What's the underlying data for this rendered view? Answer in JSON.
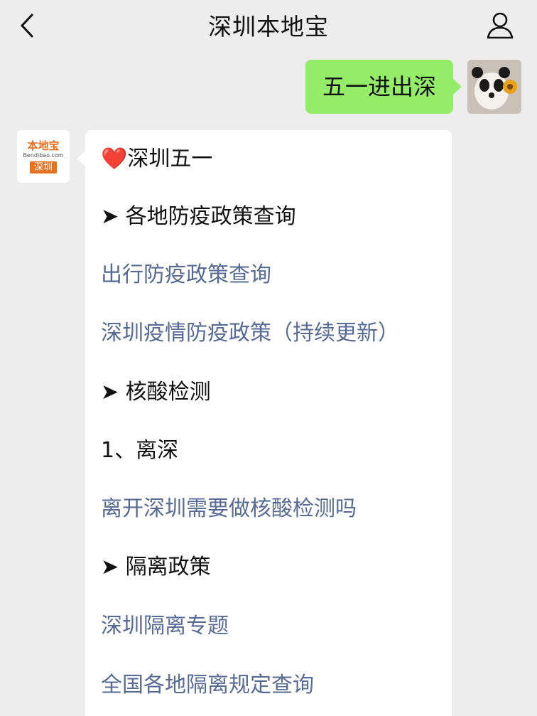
{
  "header": {
    "title": "深圳本地宝",
    "back_icon": "chevron-left-icon",
    "profile_icon": "person-outline-icon"
  },
  "sent_message": {
    "text": "五一进出深"
  },
  "sender_avatar": {
    "logo_main": "本地宝",
    "logo_sub": "Bendibao.com",
    "logo_city": "深圳"
  },
  "reply": {
    "title_icon": "❤️",
    "title": "深圳五一",
    "sections": [
      {
        "heading": "➤ 各地防疫政策查询"
      },
      {
        "heading": "➤ 核酸检测"
      },
      {
        "heading": "➤ 隔离政策"
      }
    ],
    "links": [
      "出行防疫政策查询",
      "深圳疫情防疫政策（持续更新）",
      "离开深圳需要做核酸检测吗",
      "深圳隔离专题",
      "全国各地隔离规定查询"
    ],
    "sub_item": "1、离深"
  },
  "colors": {
    "sent_bubble": "#95ec69",
    "link": "#576b95",
    "background": "#ededed",
    "brand": "#e8701e"
  }
}
